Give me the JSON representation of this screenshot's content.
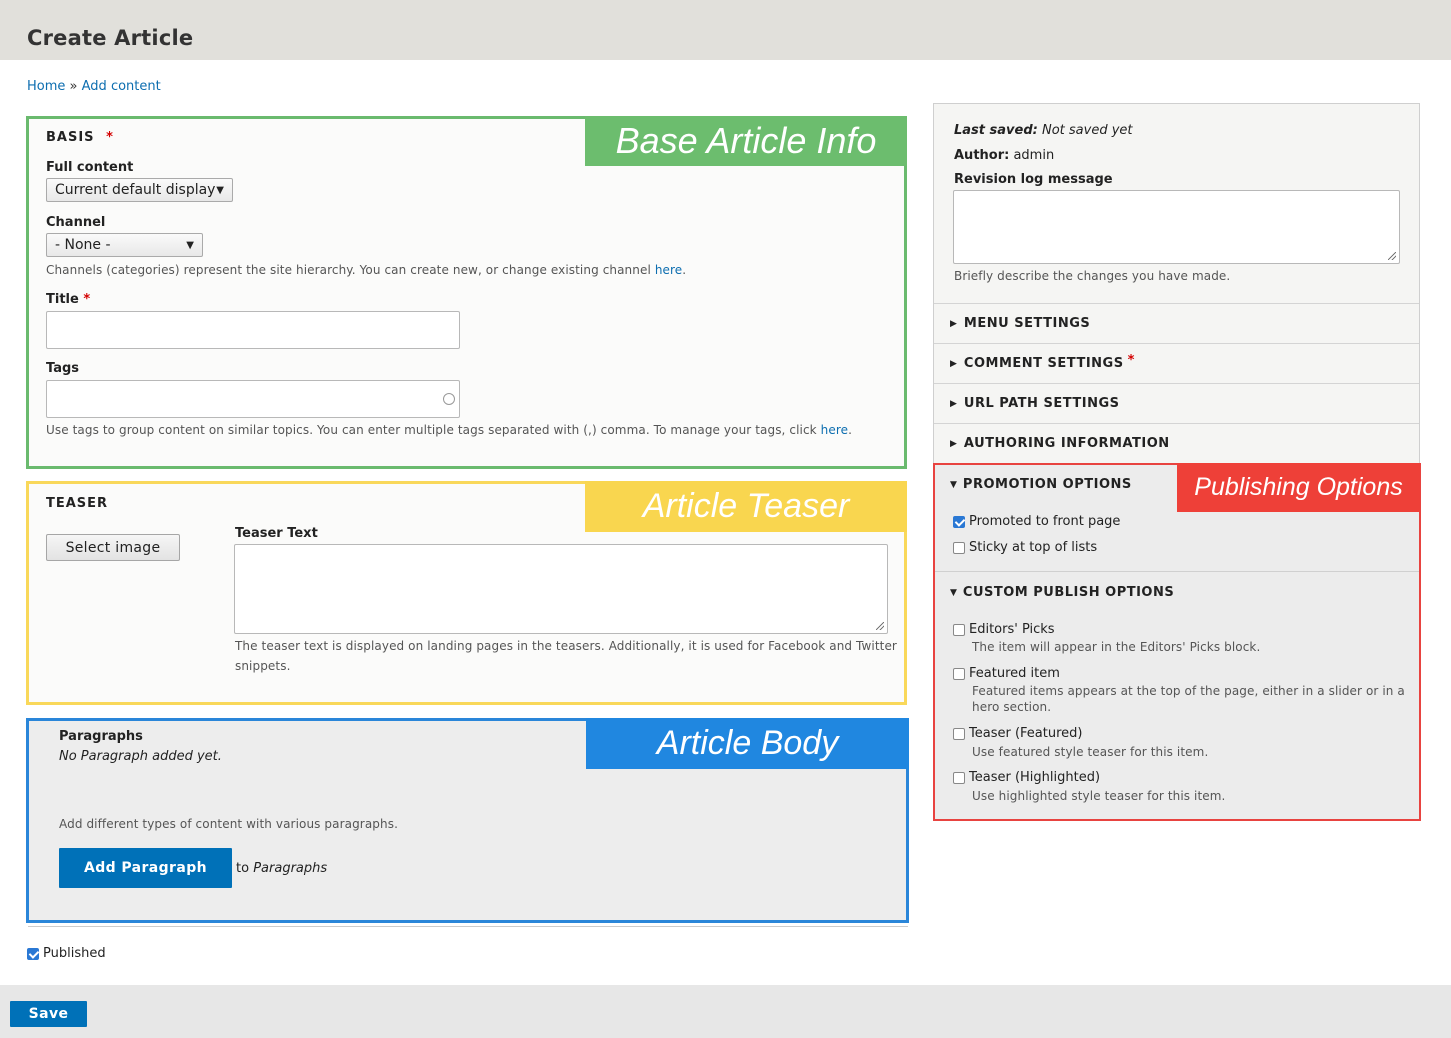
{
  "page": {
    "title": "Create Article"
  },
  "breadcrumb": {
    "home": "Home",
    "separator": "»",
    "current": "Add content"
  },
  "basis": {
    "section_label": "BASIS",
    "required": "*",
    "ribbon": "Base Article Info",
    "full_content_label": "Full content",
    "full_content_value": "Current default display",
    "channel_label": "Channel",
    "channel_value": "- None -",
    "channel_desc": "Channels (categories) represent the site hierarchy. You can create new, or change existing channel",
    "channel_link": "here",
    "title_label": "Title",
    "tags_label": "Tags",
    "tags_desc": "Use tags to group content on similar topics. You can enter multiple tags separated with (,) comma. To manage your tags, click",
    "tags_link": "here"
  },
  "teaser": {
    "section_label": "TEASER",
    "ribbon": "Article Teaser",
    "select_image": "Select image",
    "text_label": "Teaser Text",
    "text_desc_1": "The teaser text is displayed on landing pages in the teasers. Additionally, it is used for Facebook and Twitter",
    "text_desc_2": "snippets."
  },
  "body": {
    "ribbon": "Article Body",
    "paragraphs_label": "Paragraphs",
    "empty_text": "No Paragraph added yet.",
    "hint": "Add different types of content with various paragraphs.",
    "add_button": "Add Paragraph",
    "to_text": "to",
    "to_target": "Paragraphs"
  },
  "published": {
    "label": "Published",
    "checked": true
  },
  "save_button": "Save",
  "sidebar": {
    "last_saved_label": "Last saved:",
    "last_saved_value": "Not saved yet",
    "author_label": "Author:",
    "author_value": "admin",
    "revision_label": "Revision log message",
    "revision_desc": "Briefly describe the changes you have made.",
    "sections": [
      "MENU SETTINGS",
      "COMMENT SETTINGS",
      "URL PATH SETTINGS",
      "AUTHORING INFORMATION"
    ],
    "comment_required": "*",
    "promotion": {
      "title": "PROMOTION OPTIONS",
      "ribbon": "Publishing Options",
      "promoted": "Promoted to front page",
      "promoted_checked": true,
      "sticky": "Sticky at top of lists",
      "sticky_checked": false
    },
    "custom": {
      "title": "CUSTOM PUBLISH OPTIONS",
      "items": [
        {
          "label": "Editors' Picks",
          "desc": "The item will appear in the Editors' Picks block.",
          "desc2": ""
        },
        {
          "label": "Featured item",
          "desc": "Featured items appears at the top of the page, either in a slider or in a",
          "desc2": "hero section."
        },
        {
          "label": "Teaser (Featured)",
          "desc": "Use featured style teaser for this item.",
          "desc2": ""
        },
        {
          "label": "Teaser (Highlighted)",
          "desc": "Use highlighted style teaser for this item.",
          "desc2": ""
        }
      ]
    }
  },
  "colors": {
    "green": "#6cbd6e",
    "yellow": "#f9d64f",
    "blue": "#2087e0",
    "red": "#ee4038",
    "link": "#0d6eb0",
    "primary": "#0071b8"
  }
}
